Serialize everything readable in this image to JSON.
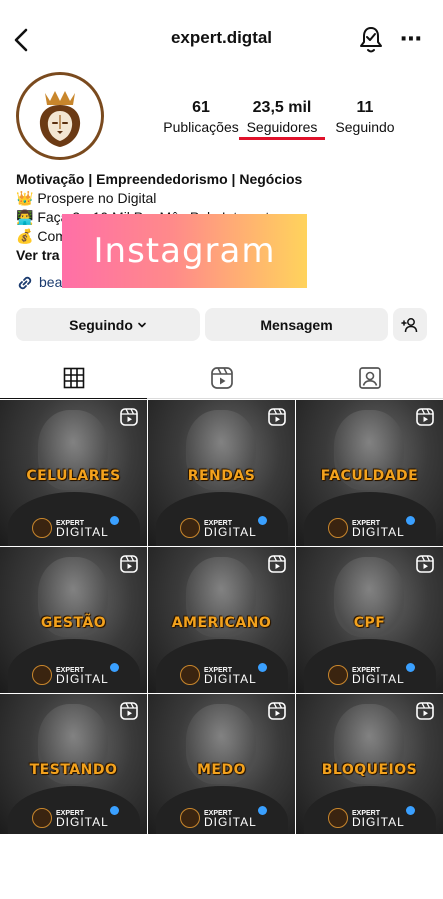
{
  "header": {
    "handle": "expert.digtal",
    "more_icon": "⋯"
  },
  "stats": {
    "posts_count": "61",
    "posts_label": "Publicações",
    "followers_count": "23,5 mil",
    "followers_label": "Seguidores",
    "following_count": "11",
    "following_label": "Seguindo"
  },
  "bio": {
    "name": "Motivação | Empreendedorismo | Negócios",
    "line1_icon": "👑",
    "line1": "Prospere no Digital",
    "line2_icon": "👨‍💻",
    "line2": "Faça 3 - 10 Mil Por Mês Pela Internet",
    "line3_icon": "💰",
    "line3": "Com",
    "more_label": "Ver tra",
    "link_text": "bea"
  },
  "overlay": {
    "text": "Instagram"
  },
  "buttons": {
    "follow_label": "Seguindo",
    "message_label": "Mensagem"
  },
  "posts": [
    {
      "caption": "CELULARES"
    },
    {
      "caption": "RENDAS"
    },
    {
      "caption": "FACULDADE"
    },
    {
      "caption": "GESTÃO"
    },
    {
      "caption": "AMERICANO"
    },
    {
      "caption": "CPF"
    },
    {
      "caption": "TESTANDO"
    },
    {
      "caption": "MEDO"
    },
    {
      "caption": "BLOQUEIOS"
    }
  ],
  "post_brand": {
    "line1": "EXPERT",
    "line2": "DIGITAL"
  },
  "colors": {
    "accent_underline": "#e0112a",
    "caption_gold": "#f3a21d"
  }
}
